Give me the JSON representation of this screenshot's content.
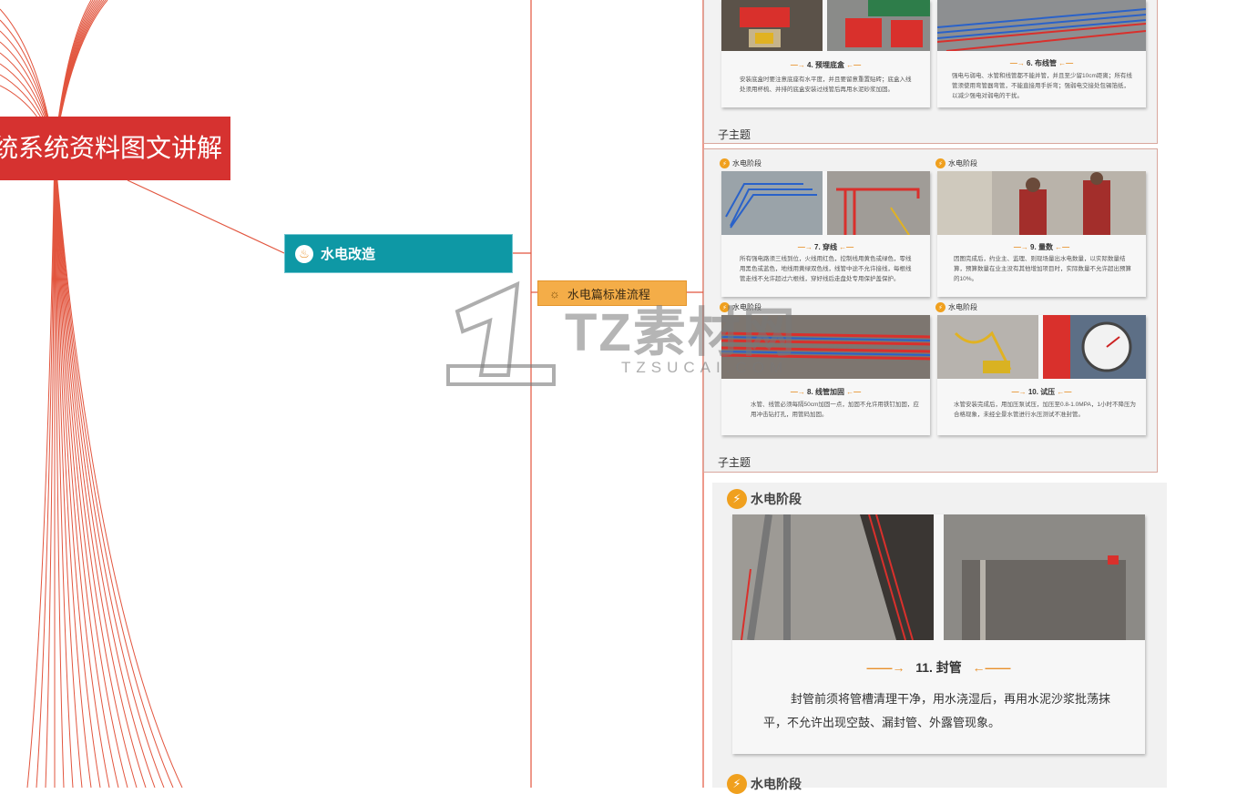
{
  "colors": {
    "central": "#d63230",
    "main_node": "#0e98a5",
    "sub_node": "#f4ad48",
    "branch_line": "#e2553e",
    "accent": "#f0a01e"
  },
  "central_topic": {
    "label": "统系统资料图文讲解"
  },
  "main_node": {
    "label": "水电改造",
    "icon": "flame-icon"
  },
  "sub_node": {
    "label": "水电篇标准流程",
    "icon": "bulb-icon"
  },
  "panels": [
    {
      "subtopic_label": "子主题"
    },
    {
      "subtopic_label": "子主题"
    }
  ],
  "cards_top": [
    {
      "step": "4. 预埋底盒",
      "desc": "安装底盒时要注意底座有水平度，并且要留意重置贴砖；底盒入线处须用杯梳、并排的底盒安装过线管后再用水泥砂浆加固。"
    },
    {
      "step": "6. 布线管",
      "desc": "强电与弱电、水管和线管都不能并管，并且至少留10cm距离；所有线管须使用弯管器弯管，不能直接用手折弯；强弱电交接处包锡箔纸，以减少强电对弱电的干扰。"
    }
  ],
  "cards_mid": [
    {
      "stage": "水电阶段",
      "step": "7. 穿线",
      "desc": "所有强电路须三线到位，火线用红色，控制线用黄色或绿色，零线用黑色或蓝色，地线用黄绿双色线，线管中途不允许接线，每根线管走线不允许超过六根线，穿好线后走盘处专用保护盖保护。"
    },
    {
      "stage": "水电阶段",
      "step": "9. 量数",
      "desc": "因图完成后，约业主、监理、则现场量出水电数量，以实际数量结算，预算数量在业主没有其他增加项目时，实际数量不允许超出预算的10%。"
    },
    {
      "stage": "水电阶段",
      "step": "8. 线管加固",
      "desc": "水管、线管必须每隔50cm加固一点，加固不允许用铁钉加固，应用冲击钻打孔，用管码加固。"
    },
    {
      "stage": "水电阶段",
      "step": "10. 试压",
      "desc": "水管安装完成后，用加压泵试压，加压至0.8-1.0MPA，1小时不降压为合格现象，未经全景水管进行水压测试不准封管。"
    }
  ],
  "big_card": {
    "stage": "水电阶段",
    "step": "11. 封管",
    "desc": "封管前须将管槽清理干净，用水浇湿后，再用水泥沙浆批荡抹平，不允许出现空鼓、漏封管、外露管现象。"
  },
  "next_stage": {
    "stage": "水电阶段"
  },
  "watermark": {
    "text": "TZ素材网",
    "sub": "TZSUCAI.COM"
  }
}
